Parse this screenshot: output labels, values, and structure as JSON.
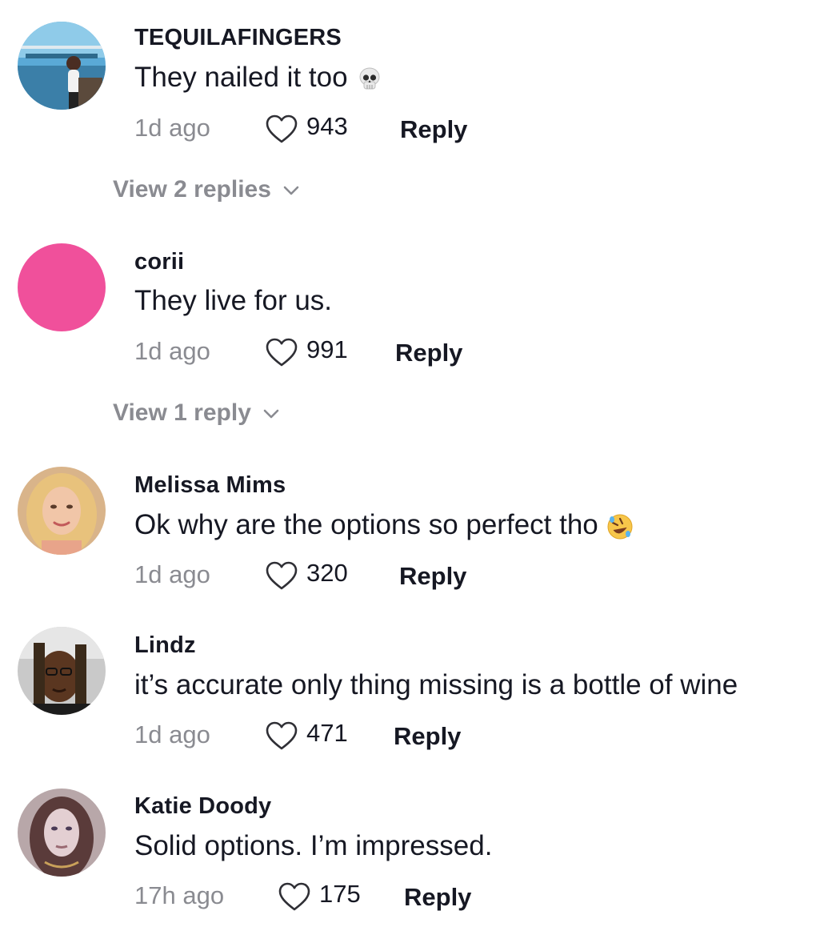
{
  "comments": [
    {
      "username": "TEQUILAFINGERS",
      "text": "They nailed it too",
      "emoji_icon": "skull-emoji",
      "time": "1d ago",
      "likes": "943",
      "reply_label": "Reply",
      "view_replies": "View 2 replies"
    },
    {
      "username": "corii",
      "text": "They live for us.",
      "avatar_color": "#f0509b",
      "time": "1d ago",
      "likes": "991",
      "reply_label": "Reply",
      "view_replies": "View 1 reply"
    },
    {
      "username": "Melissa Mims",
      "text": "Ok why are the options so perfect tho",
      "emoji_icon": "rolling-on-floor-laughing-emoji",
      "time": "1d ago",
      "likes": "320",
      "reply_label": "Reply"
    },
    {
      "username": "Lindz",
      "text": "it’s accurate only thing missing is a bottle of wine",
      "time": "1d ago",
      "likes": "471",
      "reply_label": "Reply"
    },
    {
      "username": "Katie Doody",
      "text": "Solid options. I’m impressed.",
      "time": "17h ago",
      "likes": "175",
      "reply_label": "Reply"
    }
  ],
  "colors": {
    "text_primary": "#161823",
    "text_secondary": "#8a8b91",
    "background": "#ffffff"
  }
}
